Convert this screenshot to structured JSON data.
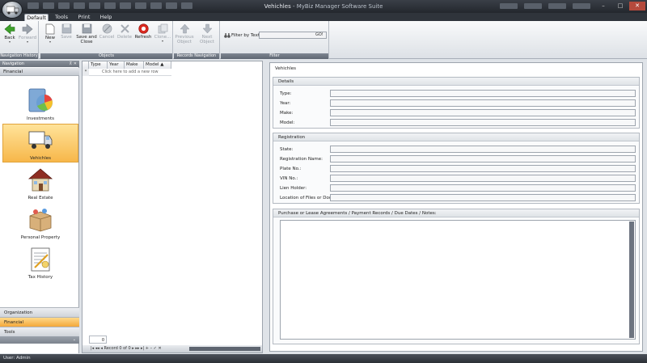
{
  "window": {
    "title": "Vehichles",
    "title_suffix": " - MyBiz Manager Software Suite",
    "controls": {
      "minimize": "–",
      "maximize": "□",
      "close": "✕"
    }
  },
  "tabs": [
    {
      "label": "Default",
      "active": true
    },
    {
      "label": "Tools",
      "active": false
    },
    {
      "label": "Print",
      "active": false
    },
    {
      "label": "Help",
      "active": false
    }
  ],
  "ribbon": {
    "navigation_history": {
      "label": "Navigation History",
      "back": "Back",
      "forward": "Forward"
    },
    "objects": {
      "label": "Objects",
      "new": "New",
      "save": "Save",
      "save_close_line1": "Save and",
      "save_close_line2": "Close",
      "cancel": "Cancel",
      "delete": "Delete",
      "refresh": "Refresh",
      "clone": "Clone..."
    },
    "records_navigation": {
      "label": "Records Navigation",
      "previous_line1": "Previous",
      "previous_line2": "Object",
      "next": "Next Object"
    },
    "filter": {
      "label": "Filter",
      "filter_by_text": "Filter by Text",
      "go": "GO!"
    }
  },
  "nav": {
    "header": "Navigation",
    "header_btns": "⊼  ✕",
    "section": "Financial",
    "items": [
      {
        "label": "Investments",
        "icon": "pie-chart-icon",
        "active": false
      },
      {
        "label": "Vehichles",
        "icon": "truck-icon",
        "active": true
      },
      {
        "label": "Real Estate",
        "icon": "house-icon",
        "active": false
      },
      {
        "label": "Personal Property",
        "icon": "box-icon",
        "active": false
      },
      {
        "label": "Tax History",
        "icon": "document-icon",
        "active": false
      }
    ],
    "categories": [
      {
        "label": "Organization",
        "active": false
      },
      {
        "label": "Financial",
        "active": true
      },
      {
        "label": "Tools",
        "active": false
      }
    ],
    "chevron": "⌄"
  },
  "grid": {
    "columns": [
      "Type",
      "Year",
      "Make",
      "Model ▲"
    ],
    "new_row_marker": "*",
    "new_row_text": "Click here to add a new row",
    "footer_count": "0",
    "record_text": "|◂  ◂◂  ◂   Record 0 of 0   ▸  ▸▸  ▸|  +  –  ✓  ✕"
  },
  "detail": {
    "title": "Vehichles",
    "details_section": {
      "label": "Details",
      "fields": [
        {
          "label": "Type:",
          "value": ""
        },
        {
          "label": "Year:",
          "value": ""
        },
        {
          "label": "Make:",
          "value": ""
        },
        {
          "label": "Model:",
          "value": ""
        }
      ]
    },
    "registration_section": {
      "label": "Registration",
      "fields": [
        {
          "label": "State:",
          "value": ""
        },
        {
          "label": "Registration Name:",
          "value": ""
        },
        {
          "label": "Plate No.:",
          "value": ""
        },
        {
          "label": "VIN No.:",
          "value": ""
        },
        {
          "label": "Lien Holder:",
          "value": ""
        },
        {
          "label": "Location of Files or Docs:",
          "value": ""
        }
      ]
    },
    "notes_section": {
      "label": "Purchase or Lease Agreements / Payment Records / Due Dates / Notes:"
    }
  },
  "status": {
    "user": "User: Admin"
  },
  "colors": {
    "accent": "#f7b74a",
    "chrome_dark": "#2b2f35",
    "close_button": "#b54a3c"
  }
}
